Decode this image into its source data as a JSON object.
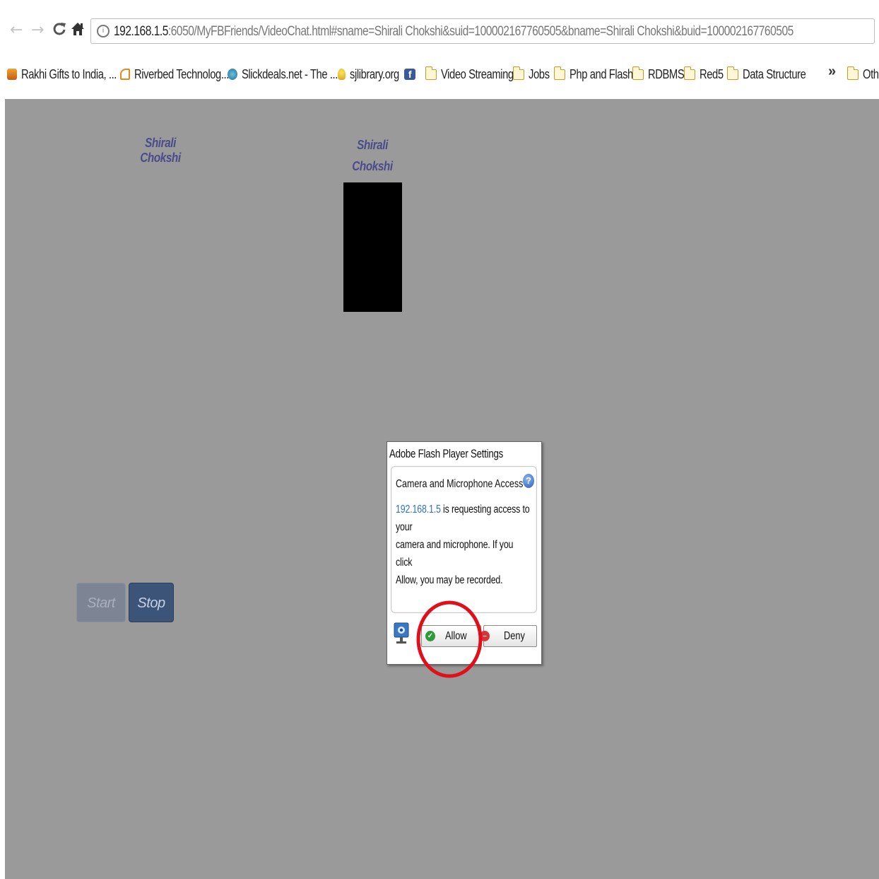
{
  "browser": {
    "nav": {
      "back_glyph": "←",
      "forward_glyph": "→",
      "reload_glyph": "C",
      "home_glyph": "🏠"
    },
    "address_bar": {
      "host": "192.168.1.5",
      "rest": ":6050/MyFBFriends/VideoChat.html#sname=Shirali Chokshi&suid=100002167760505&bname=Shirali Chokshi&buid=100002167760505"
    },
    "bookmarks": [
      {
        "label": "Rakhi Gifts to India, ...",
        "icon": "gift-icon"
      },
      {
        "label": "Riverbed Technolog...",
        "icon": "riverbed-icon"
      },
      {
        "label": "Slickdeals.net - The ...",
        "icon": "slickdeals-icon"
      },
      {
        "label": "sjlibrary.org",
        "icon": "bulb-icon"
      },
      {
        "label": "",
        "icon": "facebook-icon"
      },
      {
        "label": "Video Streaming",
        "icon": "folder-icon"
      },
      {
        "label": "Jobs",
        "icon": "folder-icon"
      },
      {
        "label": "Php and Flash",
        "icon": "folder-icon"
      },
      {
        "label": "RDBMS",
        "icon": "folder-icon"
      },
      {
        "label": "Red5",
        "icon": "folder-icon"
      },
      {
        "label": "Data Structure",
        "icon": "folder-icon"
      }
    ],
    "overflow_chevron": "»",
    "other_bookmarks": "Oth"
  },
  "page": {
    "self_name": "Shirali Chokshi",
    "buddy_name": "Shirali Chokshi",
    "start_label": "Start",
    "stop_label": "Stop",
    "background_color": "#9a9a9a"
  },
  "flash_dialog": {
    "title": "Adobe Flash Player Settings",
    "heading": "Camera and Microphone Access",
    "help_glyph": "?",
    "requester": "192.168.1.5",
    "message_line1": " is requesting access to your",
    "message_line2": "camera and microphone. If you click",
    "message_line3": "Allow, you may be recorded.",
    "allow_label": "Allow",
    "deny_label": "Deny"
  },
  "colors": {
    "name_label": "#4a4c8a",
    "stop_button": "#3d5479",
    "annotation": "#e0101a"
  }
}
